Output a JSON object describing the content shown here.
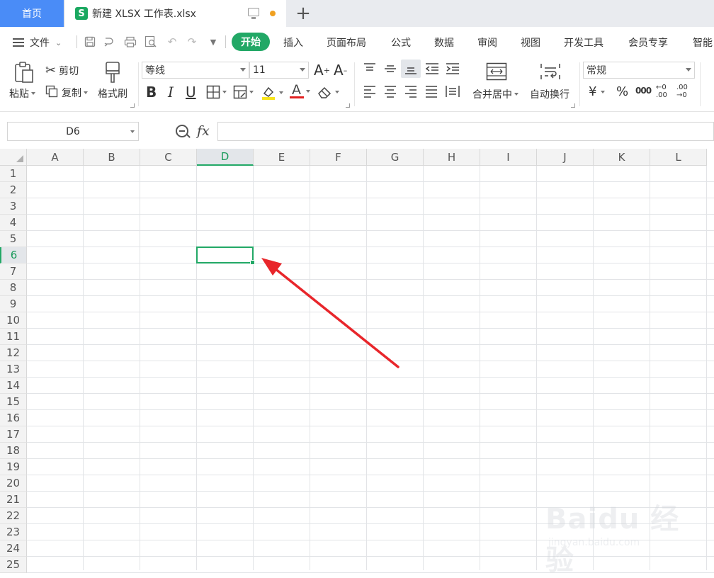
{
  "tabs": {
    "home": "首页",
    "doc": "新建 XLSX 工作表.xlsx",
    "doc_icon": "S"
  },
  "menu": {
    "file": "文件",
    "items": [
      "开始",
      "插入",
      "页面布局",
      "公式",
      "数据",
      "审阅",
      "视图",
      "开发工具",
      "会员专享",
      "智能"
    ]
  },
  "ribbon": {
    "paste": "粘贴",
    "cut": "剪切",
    "copy": "复制",
    "format_painter": "格式刷",
    "font_name": "等线",
    "font_size": "11",
    "bold": "B",
    "italic": "I",
    "underline": "U",
    "merge_center": "合并居中",
    "wrap_text": "自动换行",
    "number_format": "常规",
    "currency": "¥",
    "percent": "%",
    "thousands": "000",
    "inc_decimal": "←0 .00",
    "dec_decimal": ".00 →0"
  },
  "formula_bar": {
    "name_box": "D6",
    "fx": "fx",
    "value": ""
  },
  "grid": {
    "columns": [
      "A",
      "B",
      "C",
      "D",
      "E",
      "F",
      "G",
      "H",
      "I",
      "J",
      "K",
      "L"
    ],
    "rows": [
      "1",
      "2",
      "3",
      "4",
      "5",
      "6",
      "7",
      "8",
      "9",
      "10",
      "11",
      "12",
      "13",
      "14",
      "15",
      "16",
      "17",
      "18",
      "19",
      "20",
      "21",
      "22",
      "23",
      "24",
      "25"
    ],
    "active_column": "D",
    "active_row": "6"
  },
  "watermark": {
    "brand": "Baidu 经验",
    "url": "jingyan.baidu.com"
  },
  "colors": {
    "accent_green": "#22a866",
    "tab_blue": "#4a8cf7",
    "arrow_red": "#e8262b"
  }
}
